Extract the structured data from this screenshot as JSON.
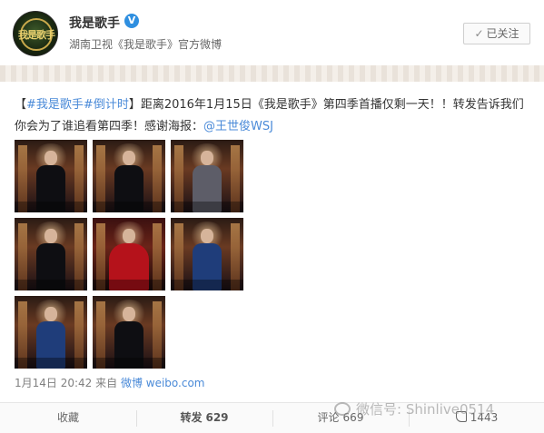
{
  "header": {
    "avatar_text": "我是歌手",
    "name": "我是歌手",
    "verified_glyph": "V",
    "subtitle": "湖南卫视《我是歌手》官方微博",
    "follow_check": "✓",
    "follow_label": "已关注"
  },
  "post": {
    "bracket_open": "【",
    "tag1": "#我是歌手#",
    "tag2": "倒计时",
    "bracket_close": "】",
    "body": "距离2016年1月15日《我是歌手》第四季首播仅剩一天！！转发告诉我们你会为了谁追看第四季！感谢海报：",
    "mention": "@王世俊WSJ"
  },
  "images": [
    {
      "style": "dark"
    },
    {
      "style": "dark"
    },
    {
      "style": "grey"
    },
    {
      "style": "dark"
    },
    {
      "style": "red"
    },
    {
      "style": "blue"
    },
    {
      "style": "blue"
    },
    {
      "style": "dark"
    }
  ],
  "meta": {
    "time": "1月14日 20:42",
    "from_label": " 来自 ",
    "source": "微博 weibo.com"
  },
  "watermark": {
    "text": "微信号: Shinlive0514"
  },
  "footer": {
    "favorite": "收藏",
    "repost_label": "转发",
    "repost_count": "629",
    "comment_label": "评论",
    "comment_count": "669",
    "like_count": "1443"
  },
  "colors": {
    "link": "#4a8ad8",
    "verified": "#2f8fe0"
  }
}
